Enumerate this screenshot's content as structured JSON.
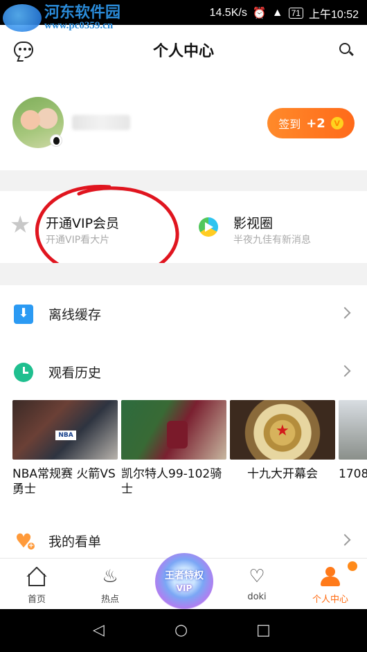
{
  "status_bar": {
    "speed": "14.5K/s",
    "battery": "71",
    "time": "上午10:52"
  },
  "watermark": {
    "title": "河东软件园",
    "url": "www.pc0359.cn"
  },
  "header": {
    "title": "个人中心",
    "left_icon": "message-icon",
    "right_icon": "search-icon"
  },
  "profile": {
    "checkin_label": "签到",
    "checkin_points": "+2",
    "coin_symbol": "V"
  },
  "cards": {
    "vip_title": "开通VIP会员",
    "vip_sub": "开通VIP看大片",
    "circle_title": "影视圈",
    "circle_sub": "半夜九佳有新消息"
  },
  "rows": {
    "offline": "离线缓存",
    "history": "观看历史",
    "watchlist": "我的看单"
  },
  "history_items": [
    {
      "caption": "NBA常规赛 火箭VS勇士",
      "image_text": "NBA"
    },
    {
      "caption": "凯尔特人99-102骑士"
    },
    {
      "caption": "十九大开幕会"
    },
    {
      "caption": "1708"
    }
  ],
  "bottom_nav": {
    "home": "首页",
    "hot": "热点",
    "vip_line1": "王者特权",
    "vip_line2": "VIP",
    "doki": "doki",
    "me": "个人中心"
  },
  "colors": {
    "accent": "#ff6a10",
    "annotation_circle": "#e0151f"
  }
}
